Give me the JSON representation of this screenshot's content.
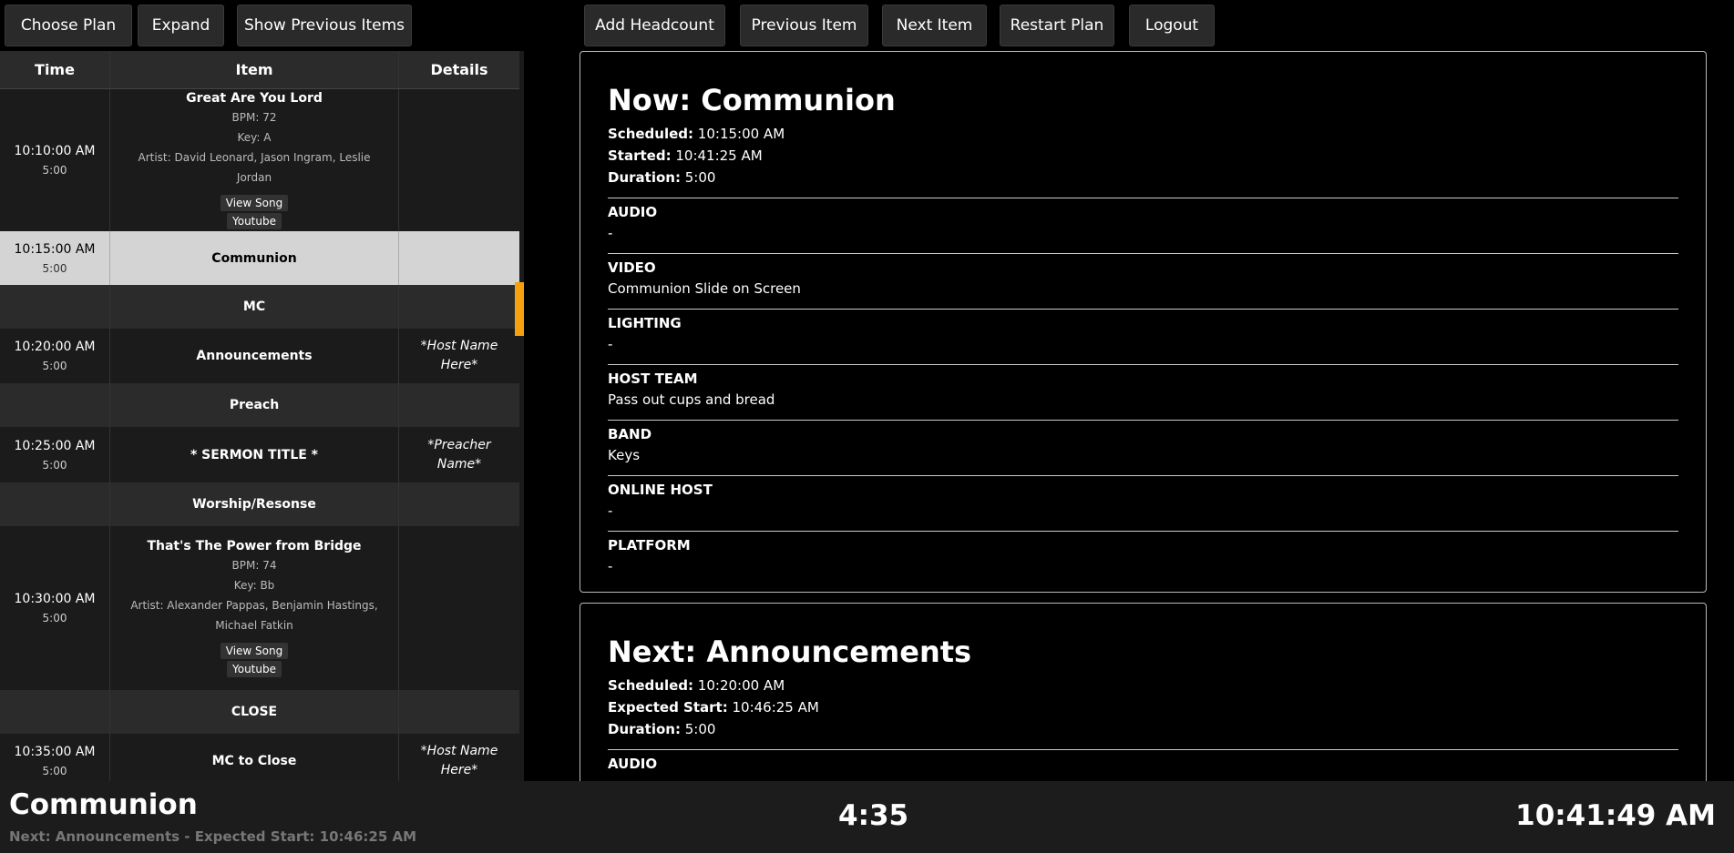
{
  "toolbar": {
    "choose_plan": "Choose Plan",
    "expand": "Expand",
    "show_previous": "Show Previous Items",
    "add_headcount": "Add Headcount",
    "previous_item": "Previous Item",
    "next_item": "Next Item",
    "restart_plan": "Restart Plan",
    "logout": "Logout"
  },
  "schedule": {
    "headers": {
      "time": "Time",
      "item": "Item",
      "details": "Details"
    },
    "rows": [
      {
        "time": "10:10:00 AM",
        "duration": "5:00",
        "title": "Great Are You Lord",
        "bpm": "BPM: 72",
        "key": "Key: A",
        "artist": "Artist: David Leonard, Jason Ingram, Leslie Jordan",
        "view_song": "View Song",
        "youtube": "Youtube"
      },
      {
        "time": "10:15:00 AM",
        "duration": "5:00",
        "title": "Communion"
      },
      {
        "title": "MC"
      },
      {
        "time": "10:20:00 AM",
        "duration": "5:00",
        "title": "Announcements",
        "details": "*Host Name Here*"
      },
      {
        "title": "Preach"
      },
      {
        "time": "10:25:00 AM",
        "duration": "5:00",
        "title": "* SERMON TITLE *",
        "details": "*Preacher Name*"
      },
      {
        "title": "Worship/Resonse"
      },
      {
        "time": "10:30:00 AM",
        "duration": "5:00",
        "title": "That's The Power from Bridge",
        "bpm": "BPM: 74",
        "key": "Key: Bb",
        "artist": "Artist: Alexander Pappas, Benjamin Hastings, Michael Fatkin",
        "view_song": "View Song",
        "youtube": "Youtube"
      },
      {
        "title": "CLOSE"
      },
      {
        "time": "10:35:00 AM",
        "duration": "5:00",
        "title": "MC to Close",
        "details": "*Host Name Here*"
      }
    ]
  },
  "now": {
    "title": "Now: Communion",
    "scheduled_label": "Scheduled:",
    "scheduled": "10:15:00 AM",
    "started_label": "Started:",
    "started": "10:41:25 AM",
    "duration_label": "Duration:",
    "duration": "5:00",
    "sections": [
      {
        "title": "AUDIO",
        "value": "-"
      },
      {
        "title": "VIDEO",
        "value": "Communion Slide on Screen"
      },
      {
        "title": "LIGHTING",
        "value": "-"
      },
      {
        "title": "HOST TEAM",
        "value": "Pass out cups and bread"
      },
      {
        "title": "BAND",
        "value": "Keys"
      },
      {
        "title": "ONLINE HOST",
        "value": "-"
      },
      {
        "title": "PLATFORM",
        "value": "-"
      }
    ]
  },
  "next": {
    "title": "Next: Announcements",
    "scheduled_label": "Scheduled:",
    "scheduled": "10:20:00 AM",
    "expected_label": "Expected Start:",
    "expected": "10:46:25 AM",
    "duration_label": "Duration:",
    "duration": "5:00",
    "sections": [
      {
        "title": "AUDIO"
      }
    ]
  },
  "footer": {
    "current": "Communion",
    "next_line": "Next: Announcements - Expected Start: 10:46:25 AM",
    "timer": "4:35",
    "clock": "10:41:49 AM"
  },
  "colors": {
    "current_marker": "#f5a00e",
    "current_row": "#d4d4d4"
  }
}
